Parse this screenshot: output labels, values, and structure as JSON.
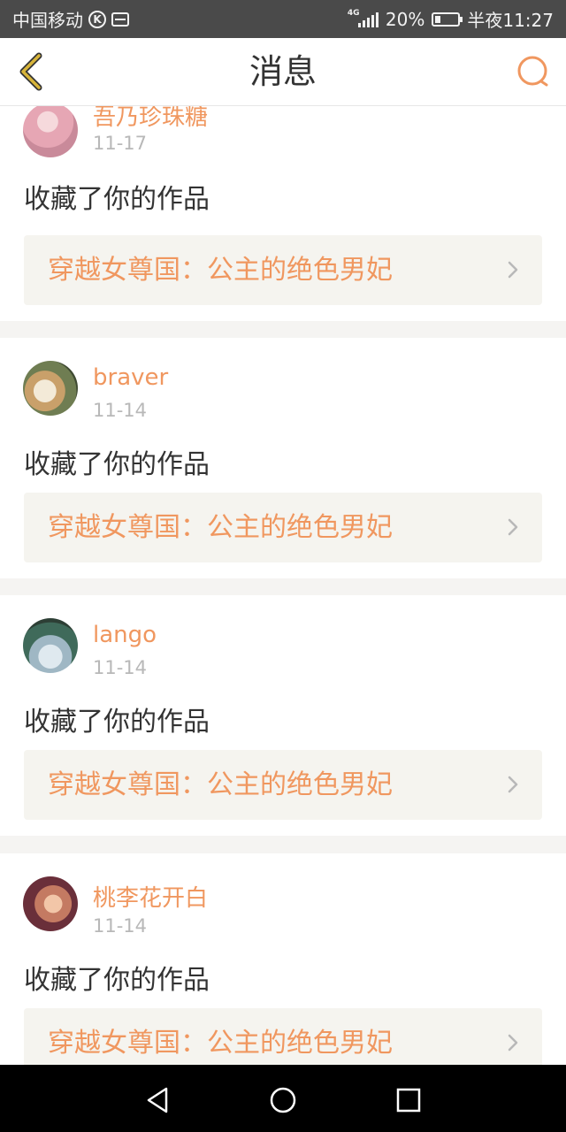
{
  "status_bar": {
    "carrier": "中国移动",
    "k_badge": "K",
    "network": "4G",
    "battery": "20%",
    "time": "半夜11:27"
  },
  "header": {
    "title": "消息",
    "back_icon": "chevron-left-icon",
    "search_icon": "search-icon"
  },
  "notifications": [
    {
      "user": "吾乃珍珠糖",
      "date": "11-17",
      "action": "收藏了你的作品",
      "work": "穿越女尊国：公主的绝色男妃"
    },
    {
      "user": "braver",
      "date": "11-14",
      "action": "收藏了你的作品",
      "work": "穿越女尊国：公主的绝色男妃"
    },
    {
      "user": "lango",
      "date": "11-14",
      "action": "收藏了你的作品",
      "work": "穿越女尊国：公主的绝色男妃"
    },
    {
      "user": "桃李花开白",
      "date": "11-14",
      "action": "收藏了你的作品",
      "work": "穿越女尊国：公主的绝色男妃"
    }
  ],
  "colors": {
    "accent": "#f0975f",
    "back_icon": "#d7b43a",
    "date": "#b8b8b8",
    "work_bg": "#f5f4ef"
  },
  "system_nav": {
    "back": "triangle-back-icon",
    "home": "circle-home-icon",
    "recents": "square-recents-icon"
  }
}
